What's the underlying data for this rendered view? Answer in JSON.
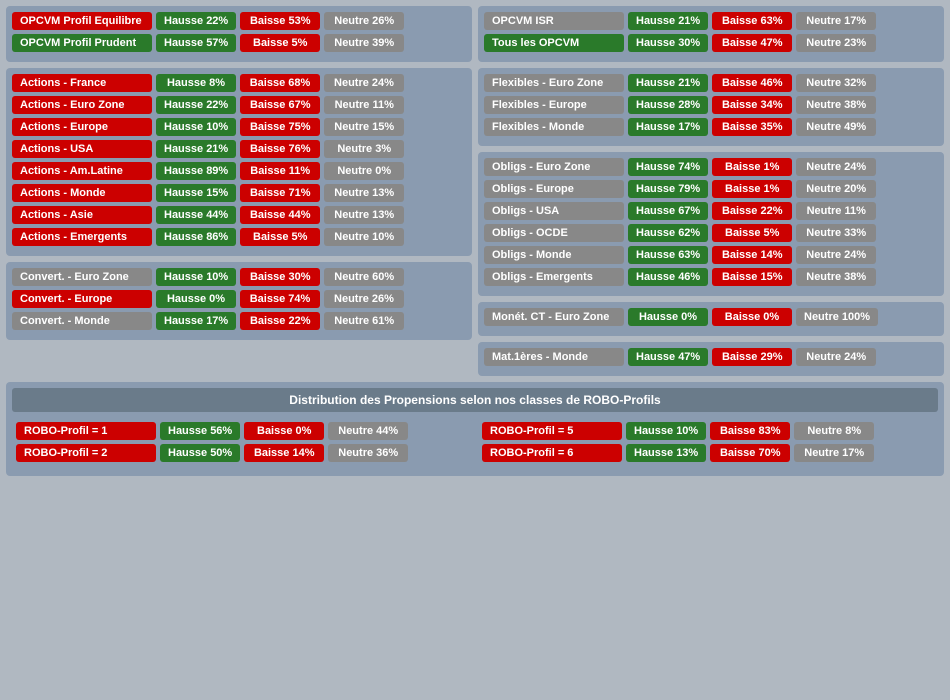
{
  "topLeft": {
    "rows1": [
      {
        "label": "OPCVM Profil Equilibre",
        "labelColor": "red",
        "hausse": "Hausse 22%",
        "baisse": "Baisse 53%",
        "neutre": "Neutre 26%"
      },
      {
        "label": "OPCVM Profil Prudent",
        "labelColor": "green",
        "hausse": "Hausse 57%",
        "baisse": "Baisse 5%",
        "neutre": "Neutre 39%"
      }
    ]
  },
  "topRight": {
    "rows1": [
      {
        "label": "OPCVM ISR",
        "labelColor": "gray",
        "hausse": "Hausse 21%",
        "baisse": "Baisse 63%",
        "neutre": "Neutre 17%"
      },
      {
        "label": "Tous les OPCVM",
        "labelColor": "green",
        "hausse": "Hausse 30%",
        "baisse": "Baisse 47%",
        "neutre": "Neutre 23%"
      }
    ]
  },
  "actionsPanel": {
    "rows": [
      {
        "label": "Actions - France",
        "labelColor": "red",
        "hausse": "Hausse 8%",
        "baisse": "Baisse 68%",
        "neutre": "Neutre 24%"
      },
      {
        "label": "Actions - Euro Zone",
        "labelColor": "red",
        "hausse": "Hausse 22%",
        "baisse": "Baisse 67%",
        "neutre": "Neutre 11%"
      },
      {
        "label": "Actions - Europe",
        "labelColor": "red",
        "hausse": "Hausse 10%",
        "baisse": "Baisse 75%",
        "neutre": "Neutre 15%"
      },
      {
        "label": "Actions - USA",
        "labelColor": "red",
        "hausse": "Hausse 21%",
        "baisse": "Baisse 76%",
        "neutre": "Neutre 3%"
      },
      {
        "label": "Actions - Am.Latine",
        "labelColor": "red",
        "hausse": "Hausse 89%",
        "baisse": "Baisse 11%",
        "neutre": "Neutre 0%"
      },
      {
        "label": "Actions - Monde",
        "labelColor": "red",
        "hausse": "Hausse 15%",
        "baisse": "Baisse 71%",
        "neutre": "Neutre 13%"
      },
      {
        "label": "Actions - Asie",
        "labelColor": "red",
        "hausse": "Hausse 44%",
        "baisse": "Baisse 44%",
        "neutre": "Neutre 13%"
      },
      {
        "label": "Actions - Emergents",
        "labelColor": "red",
        "hausse": "Hausse 86%",
        "baisse": "Baisse 5%",
        "neutre": "Neutre 10%"
      }
    ]
  },
  "flexiblesPanel": {
    "rows": [
      {
        "label": "Flexibles - Euro Zone",
        "labelColor": "gray",
        "hausse": "Hausse 21%",
        "baisse": "Baisse 46%",
        "neutre": "Neutre 32%"
      },
      {
        "label": "Flexibles - Europe",
        "labelColor": "gray",
        "hausse": "Hausse 28%",
        "baisse": "Baisse 34%",
        "neutre": "Neutre 38%"
      },
      {
        "label": "Flexibles - Monde",
        "labelColor": "gray",
        "hausse": "Hausse 17%",
        "baisse": "Baisse 35%",
        "neutre": "Neutre 49%"
      }
    ]
  },
  "obligsPanel": {
    "rows": [
      {
        "label": "Obligs - Euro Zone",
        "labelColor": "gray",
        "hausse": "Hausse 74%",
        "baisse": "Baisse 1%",
        "neutre": "Neutre 24%"
      },
      {
        "label": "Obligs - Europe",
        "labelColor": "gray",
        "hausse": "Hausse 79%",
        "baisse": "Baisse 1%",
        "neutre": "Neutre 20%"
      },
      {
        "label": "Obligs - USA",
        "labelColor": "gray",
        "hausse": "Hausse 67%",
        "baisse": "Baisse 22%",
        "neutre": "Neutre 11%"
      },
      {
        "label": "Obligs - OCDE",
        "labelColor": "gray",
        "hausse": "Hausse 62%",
        "baisse": "Baisse 5%",
        "neutre": "Neutre 33%"
      },
      {
        "label": "Obligs - Monde",
        "labelColor": "gray",
        "hausse": "Hausse 63%",
        "baisse": "Baisse 14%",
        "neutre": "Neutre 24%"
      },
      {
        "label": "Obligs - Emergents",
        "labelColor": "gray",
        "hausse": "Hausse 46%",
        "baisse": "Baisse 15%",
        "neutre": "Neutre 38%"
      }
    ]
  },
  "convertPanel": {
    "rows": [
      {
        "label": "Convert. - Euro Zone",
        "labelColor": "gray",
        "hausse": "Hausse 10%",
        "baisse": "Baisse 30%",
        "neutre": "Neutre 60%"
      },
      {
        "label": "Convert. - Europe",
        "labelColor": "red",
        "hausse": "Hausse 0%",
        "baisse": "Baisse 74%",
        "neutre": "Neutre 26%"
      },
      {
        "label": "Convert. - Monde",
        "labelColor": "gray",
        "hausse": "Hausse 17%",
        "baisse": "Baisse 22%",
        "neutre": "Neutre 61%"
      }
    ]
  },
  "monetPanel": {
    "rows": [
      {
        "label": "Monét. CT - Euro Zone",
        "labelColor": "gray",
        "hausse": "Hausse 0%",
        "baisse": "Baisse 0%",
        "neutre": "Neutre 100%"
      }
    ]
  },
  "matPanel": {
    "rows": [
      {
        "label": "Mat.1ères - Monde",
        "labelColor": "gray",
        "hausse": "Hausse 47%",
        "baisse": "Baisse 29%",
        "neutre": "Neutre 24%"
      }
    ]
  },
  "distributionTitle": "Distribution des Propensions selon nos classes de ROBO-Profils",
  "roboPanel": {
    "rows": [
      {
        "label": "ROBO-Profil = 1",
        "labelColor": "red",
        "hausse": "Hausse 56%",
        "baisse": "Baisse 0%",
        "neutre": "Neutre 44%"
      },
      {
        "label": "ROBO-Profil = 2",
        "labelColor": "red",
        "hausse": "Hausse 50%",
        "baisse": "Baisse 14%",
        "neutre": "Neutre 36%"
      }
    ],
    "rowsRight": [
      {
        "label": "ROBO-Profil = 5",
        "labelColor": "red",
        "hausse": "Hausse 10%",
        "baisse": "Baisse 83%",
        "neutre": "Neutre 8%"
      },
      {
        "label": "ROBO-Profil = 6",
        "labelColor": "red",
        "hausse": "Hausse 13%",
        "baisse": "Baisse 70%",
        "neutre": "Neutre 17%"
      }
    ]
  }
}
